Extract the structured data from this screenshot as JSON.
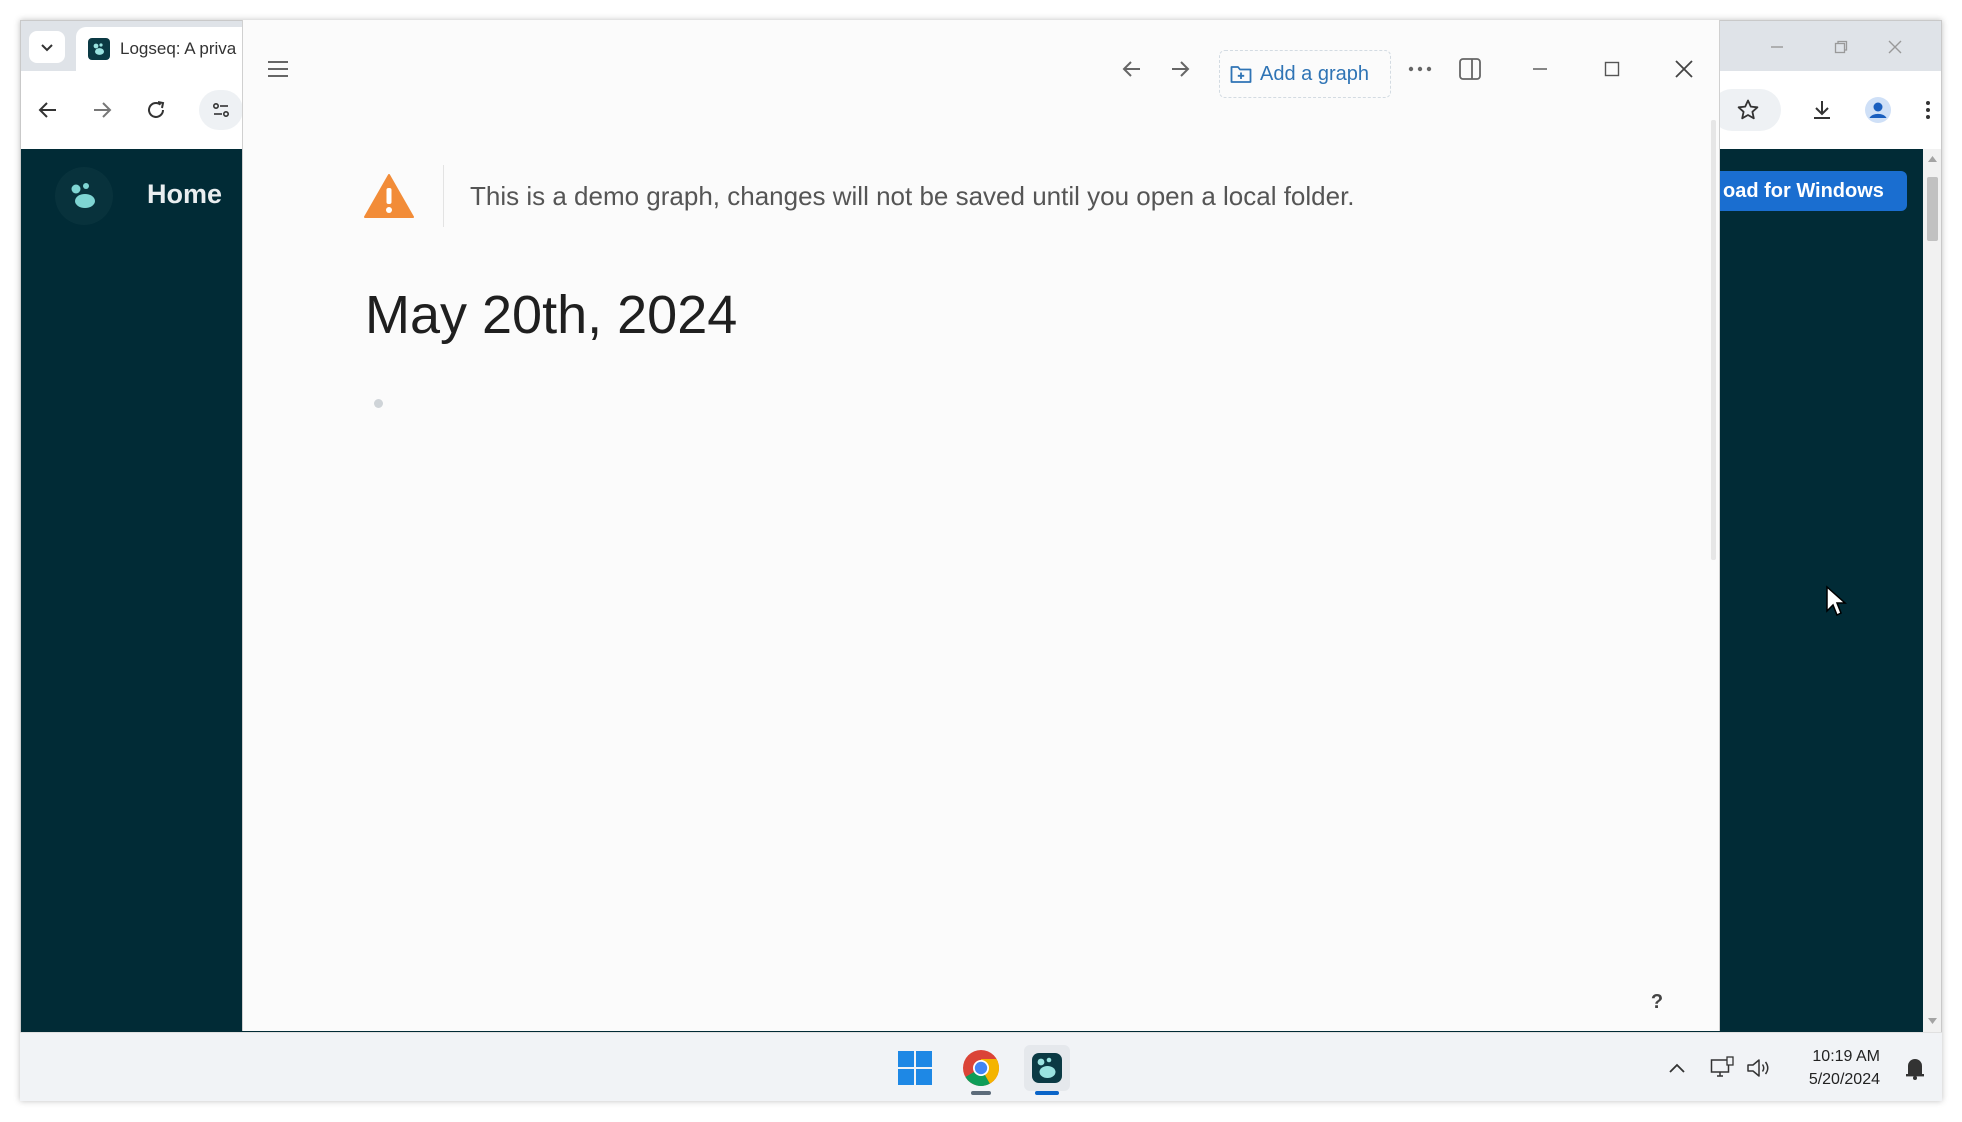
{
  "browser": {
    "tab_title": "Logseq: A priva",
    "window_controls": [
      "minimize-icon",
      "restore-icon",
      "close-icon"
    ]
  },
  "webpage": {
    "nav_home": "Home",
    "download_button": "oad for Windows"
  },
  "app": {
    "toolbar": {
      "add_graph_label": "Add a graph"
    },
    "warning_text": "This is a demo graph, changes will not be saved until you open a local folder.",
    "page_title": "May 20th, 2024",
    "help_label": "?"
  },
  "taskbar": {
    "time": "10:19 AM",
    "date": "5/20/2024"
  },
  "colors": {
    "web_background": "#012b36",
    "download_button": "#1a6ed0",
    "add_graph_text": "#2f74b5",
    "warning_icon": "#f28c38",
    "app_background": "#fbfbfb"
  }
}
